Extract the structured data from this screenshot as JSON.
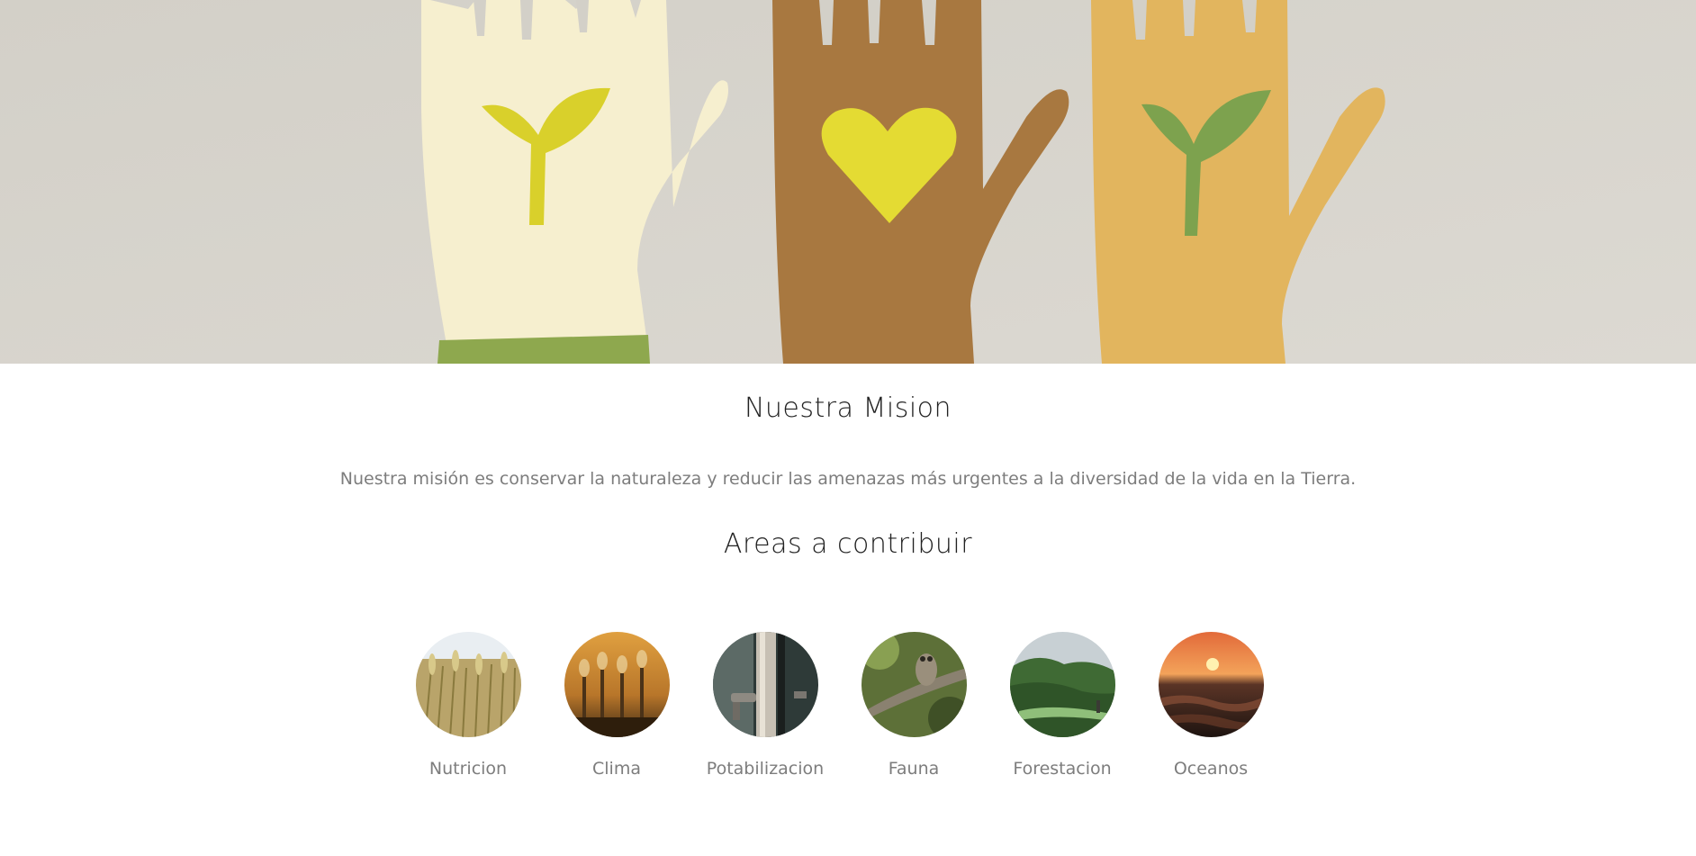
{
  "hero": {
    "image": "raised-paper-hands-with-sprout-and-heart"
  },
  "mission": {
    "title": "Nuestra Mision",
    "text": "Nuestra misión es conservar la naturaleza y reducir las amenazas más urgentes a la diversidad de la vida en la Tierra."
  },
  "areas": {
    "title": "Areas a contribuir",
    "items": [
      {
        "label": "Nutricion",
        "image": "wheat-field"
      },
      {
        "label": "Clima",
        "image": "industrial-smokestacks"
      },
      {
        "label": "Potabilizacion",
        "image": "water-faucet"
      },
      {
        "label": "Fauna",
        "image": "owl-on-branch"
      },
      {
        "label": "Forestacion",
        "image": "forest-river"
      },
      {
        "label": "Oceanos",
        "image": "ocean-sunset"
      }
    ]
  }
}
